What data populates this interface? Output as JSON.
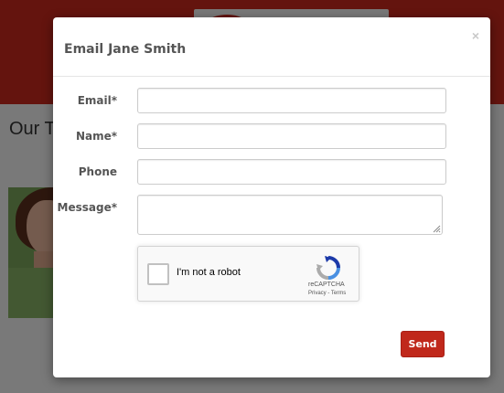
{
  "background": {
    "section_title": "Our Te"
  },
  "modal": {
    "title": "Email Jane Smith",
    "close_label": "×",
    "fields": {
      "email": {
        "label": "Email*",
        "value": ""
      },
      "name": {
        "label": "Name*",
        "value": ""
      },
      "phone": {
        "label": "Phone",
        "value": ""
      },
      "message": {
        "label": "Message*",
        "value": ""
      }
    },
    "recaptcha": {
      "checkbox_label": "I'm not a robot",
      "brand": "reCAPTCHA",
      "links": "Privacy - Terms",
      "icon": "recaptcha-logo-icon"
    },
    "send_label": "Send"
  },
  "colors": {
    "brand_red": "#c8281c",
    "send_button": "#c0281b"
  }
}
